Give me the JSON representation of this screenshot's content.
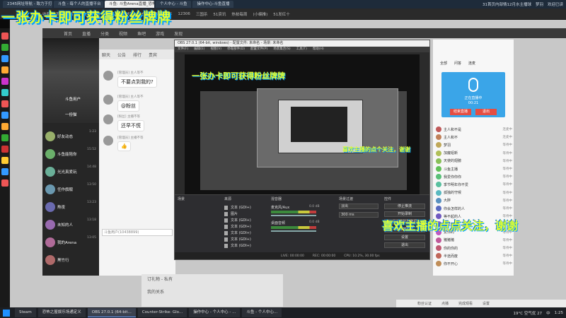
{
  "browser": {
    "tabs": [
      {
        "label": "2345网址导航 - 致力于打造",
        "active": false
      },
      {
        "label": "斗鱼 - 每个人的直播平台",
        "active": false
      },
      {
        "label": "斗鱼: 斗鱼Arena直播_恐怖之屋通关",
        "active": true
      },
      {
        "label": "个人中心 - 斗鱼",
        "active": false
      },
      {
        "label": "操作中心-斗鱼直播",
        "active": false
      }
    ],
    "tab_right": [
      "31首页内部情12月水主播球",
      "梦羽",
      "欢迎已读"
    ],
    "bookmarks": [
      "收藏",
      "首页",
      "百度",
      "淘宝",
      "知乎",
      "B站",
      "2345",
      "京东",
      "网易",
      "快手",
      "12306",
      "三国杀",
      "51资讯",
      "热帖每周",
      "(小编推)",
      "51发红十"
    ]
  },
  "overlays": {
    "top": "一张办卡即可获得粉丝牌牌",
    "inner": "一张办卡即可获得粉丝牌牌",
    "mid": "喜欢主播的点个关注，谢谢",
    "bottom": "喜欢主播的点点关注，谢谢"
  },
  "site": {
    "nav": [
      "首页",
      "直播",
      "分类",
      "视频",
      "鱼吧",
      "游戏",
      "发现"
    ]
  },
  "users": [
    {
      "name": "斗鱼用户",
      "sub": "",
      "time": ""
    },
    {
      "name": "一份猫",
      "sub": "",
      "time": ""
    },
    {
      "name": "好友动态",
      "sub": "",
      "time": "1:23"
    },
    {
      "name": "斗鱼能陪你",
      "sub": "",
      "time": "15:52"
    },
    {
      "name": "光光真爱玩",
      "sub": "",
      "time": "14:48"
    },
    {
      "name": "任作旗舰",
      "sub": "",
      "time": "13:50"
    },
    {
      "name": "熬夜",
      "sub": "",
      "time": "13:23"
    },
    {
      "name": "未知的人",
      "sub": "",
      "time": "13:18"
    },
    {
      "name": "我的Arena",
      "sub": "",
      "time": "13:05"
    },
    {
      "name": "黑竹行",
      "sub": "",
      "time": ""
    }
  ],
  "chat": {
    "tabs": [
      "聊天",
      "公告",
      "排行",
      "贵宾"
    ],
    "messages": [
      {
        "who": "[管理员] 主人等不",
        "text": "不要点到我的?"
      },
      {
        "who": "[管理员] 主人等不",
        "text": "@粉丝"
      },
      {
        "who": "[粉丝] 主播不等",
        "text": "还早不慌"
      },
      {
        "who": "[管理员] 主播不等",
        "text": "👍"
      }
    ],
    "input_placeholder": "斗鱼用户(10438899)"
  },
  "obs": {
    "title": "OBS 27.0.1 (64-bit, windows) - 配置文件: 未命名 - 场景: 未命名",
    "menu": [
      "文件(F)",
      "编辑(E)",
      "视图(V)",
      "停靠部件(D)",
      "配置文件(P)",
      "场景集合(S)",
      "工具(T)",
      "帮助(H)"
    ],
    "docks": [
      "场景",
      "来源",
      "混音器",
      "场景过渡",
      "控件"
    ],
    "sources": [
      "文本 (GDI+)",
      "图片",
      "文本 (GDI+)",
      "文本 (GDI+)",
      "文本 (GDI+)",
      "文本 (GDI+)",
      "文本 (GDI+)"
    ],
    "mixer": [
      "麦克风/Aux",
      "桌面音频"
    ],
    "mixer_db": [
      "0.0 dB",
      "0.0 dB"
    ],
    "transition": "淡出",
    "duration": "300 ms",
    "controls": [
      "停止推流",
      "开始录制",
      "启动虚拟摄像机",
      "工作室模式",
      "设置",
      "退出"
    ],
    "status": [
      "LIVE: 00:00:00",
      "REC: 00:00:00",
      "CPU: 10.2%, 30.00 fps"
    ]
  },
  "right": {
    "tabs": [
      "全部",
      "问答",
      "连麦"
    ],
    "voice_label": "正在直播中",
    "voice_time": "00:21",
    "voice_btn1": "结束直播",
    "voice_btn2": "退出",
    "users": [
      {
        "name": "主人和不是",
        "status": "连麦中"
      },
      {
        "name": "主人和不",
        "status": "连麦中"
      },
      {
        "name": "梦羽",
        "status": "等待中"
      },
      {
        "name": "加魔铝新",
        "status": "等待中"
      },
      {
        "name": "天使的翅膀",
        "status": "等待中"
      },
      {
        "name": "斗鱼主播",
        "status": "等待中"
      },
      {
        "name": "我爱你你你",
        "status": "等待中"
      },
      {
        "name": "季节明年你不爱",
        "status": "等待中"
      },
      {
        "name": "孤独的守候",
        "status": "等待中"
      },
      {
        "name": "大胖",
        "status": "等待中"
      },
      {
        "name": "你会怎样的人",
        "status": "等待中"
      },
      {
        "name": "等不起的人",
        "status": "等待中"
      },
      {
        "name": "不过如此",
        "status": "等待中"
      },
      {
        "name": "爱你的",
        "status": "等待中"
      },
      {
        "name": "猪猪猪",
        "status": "等待中"
      },
      {
        "name": "你的你的",
        "status": "等待中"
      },
      {
        "name": "半途而废",
        "status": "等待中"
      },
      {
        "name": "你不开心",
        "status": "等待中"
      }
    ]
  },
  "lower": {
    "btn1": "订礼物 - 私有",
    "btn2": "我的关系"
  },
  "bottom_strip": [
    "粉丝认证",
    "点播",
    "完成观看",
    "设置"
  ],
  "taskbar": {
    "items": [
      {
        "label": "Steam",
        "active": false
      },
      {
        "label": "恐怖之屋娱乐场通定义",
        "active": false
      },
      {
        "label": "OBS 27.0.1 (64-bit...",
        "active": true
      },
      {
        "label": "Counter-Strike: Glo...",
        "active": false
      },
      {
        "label": "操作中心 - 个人中心 - ...",
        "active": false
      },
      {
        "label": "斗鱼 - 个人中心...",
        "active": false
      }
    ],
    "tray": [
      "19°C 空气优 27",
      "中",
      "1:25"
    ]
  },
  "colors": {
    "overlay_yellow": "#e6ff2a",
    "overlay_shadow": "#00a2ff",
    "voice_blue": "#3aa5e8",
    "stop_red": "#e54d42"
  }
}
